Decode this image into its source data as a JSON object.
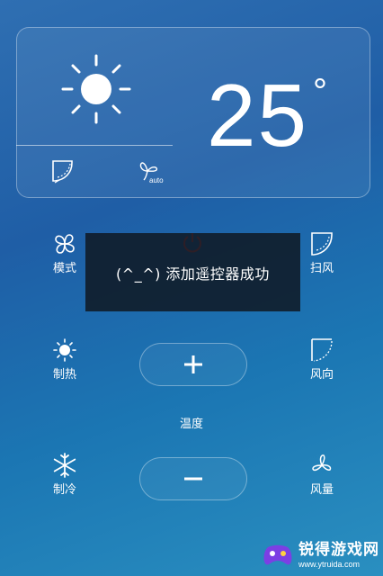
{
  "status": {
    "temperature": "25",
    "unit": "°",
    "sweep_icon": "sweep-mode-icon",
    "fan_auto_label": "auto"
  },
  "controls": {
    "mode": "模式",
    "sweep": "扫风",
    "heat": "制热",
    "direction": "风向",
    "cool": "制冷",
    "fan_speed": "风量",
    "temp_label": "温度"
  },
  "toast": {
    "message": "(^_^) 添加遥控器成功"
  },
  "watermark": {
    "title": "锐得游戏网",
    "url": "www.ytruida.com"
  },
  "colors": {
    "accent": "#ffffff",
    "toast_bg": "#0f1923"
  }
}
